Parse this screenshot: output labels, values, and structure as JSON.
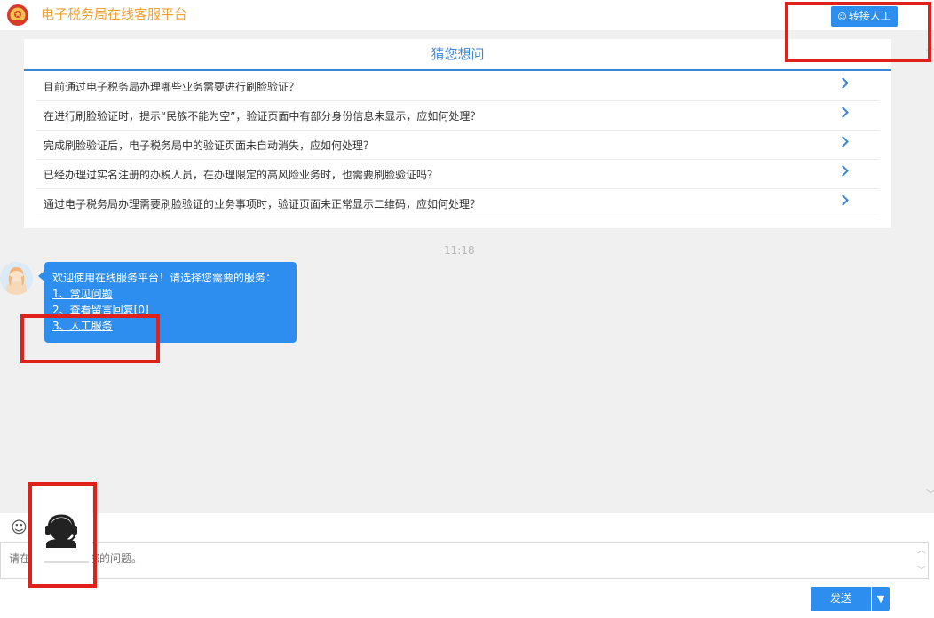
{
  "header": {
    "title": "电子税务局在线客服平台",
    "transfer_label": "转接人工"
  },
  "guess": {
    "title": "猜您想问",
    "questions": [
      "目前通过电子税务局办理哪些业务需要进行刷脸验证？",
      "在进行刷脸验证时，提示“民族不能为空”，验证页面中有部分身份信息未显示，应如何处理？",
      "完成刷脸验证后，电子税务局中的验证页面未自动消失，应如何处理？",
      "已经办理过实名注册的办税人员，在办理限定的高风险业务时，也需要刷脸验证吗？",
      "通过电子税务局办理需要刷脸验证的业务事项时，验证页面未正常显示二维码，应如何处理？"
    ]
  },
  "chat": {
    "time": "11:18",
    "message": {
      "intro": "欢迎使用在线服务平台！请选择您需要的服务：",
      "options": [
        "1、常见问题",
        "2、查看留言回复[0]",
        "3、人工服务"
      ]
    }
  },
  "input": {
    "placeholder": "请在此输入您的问题，尽量简短、准确描述您的问题。",
    "visible_left": "请在",
    "visible_right": "述您的问题。"
  },
  "send": {
    "label": "发送"
  },
  "colors": {
    "accent": "#2d8ef0",
    "title": "#f0a030",
    "annotation": "#e0201a"
  }
}
